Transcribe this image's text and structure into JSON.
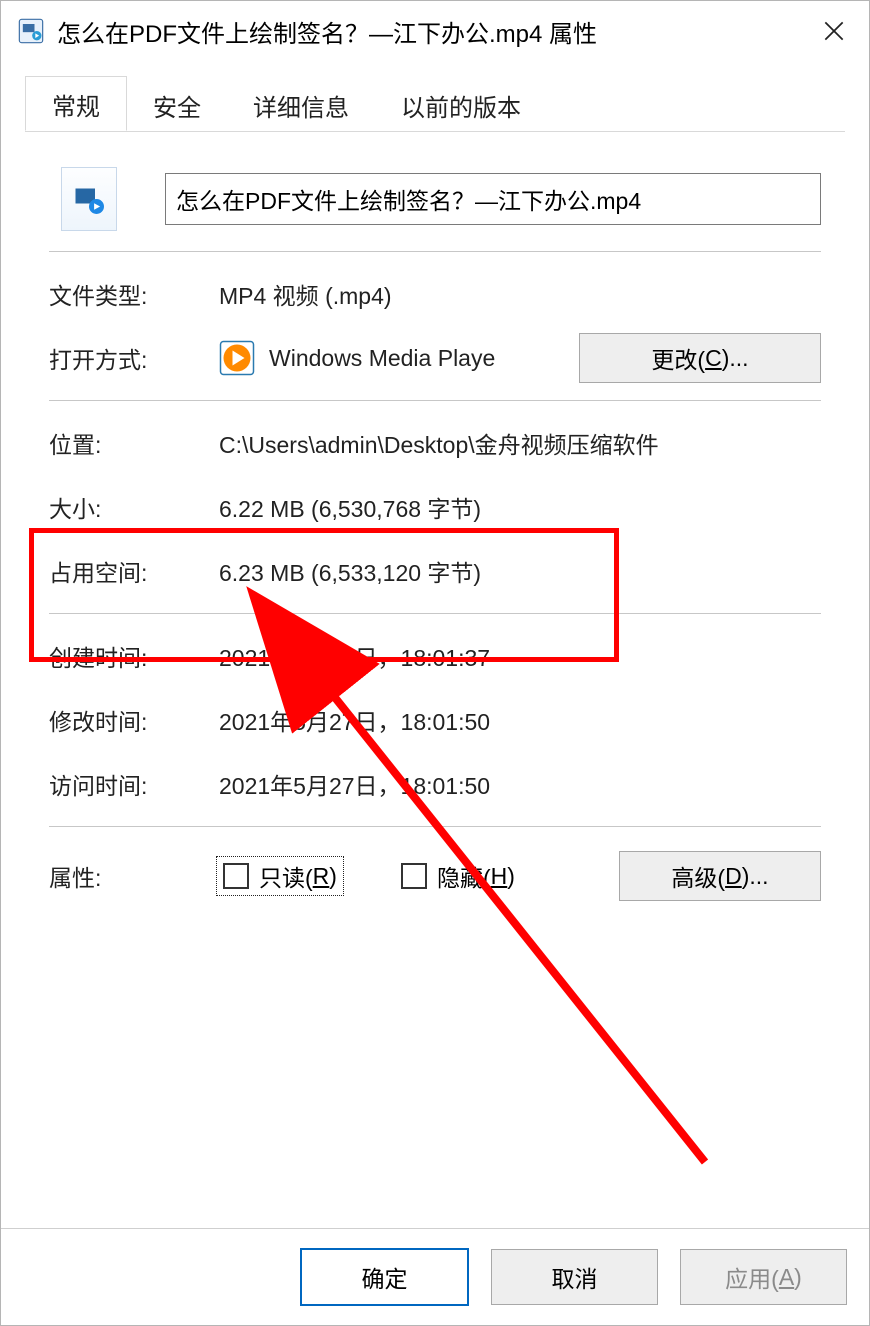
{
  "title": "怎么在PDF文件上绘制签名？—江下办公.mp4 属性",
  "tabs": [
    "常规",
    "安全",
    "详细信息",
    "以前的版本"
  ],
  "filename": "怎么在PDF文件上绘制签名？—江下办公.mp4",
  "labels": {
    "filetype": "文件类型:",
    "openwith": "打开方式:",
    "location": "位置:",
    "size": "大小:",
    "sizedisk": "占用空间:",
    "created": "创建时间:",
    "modified": "修改时间:",
    "accessed": "访问时间:",
    "attributes": "属性:",
    "readonly": "只读(",
    "readonly_key": "R",
    "readonly_close": ")",
    "hidden": "隐藏(",
    "hidden_key": "H",
    "hidden_close": ")",
    "change": "更改(",
    "change_key": "C",
    "change_close": ")...",
    "advanced": "高级(",
    "advanced_key": "D",
    "advanced_close": ")..."
  },
  "values": {
    "filetype": "MP4 视频 (.mp4)",
    "openwith": "Windows Media Playe",
    "location": "C:\\Users\\admin\\Desktop\\金舟视频压缩软件",
    "size": "6.22 MB (6,530,768 字节)",
    "sizedisk": "6.23 MB (6,533,120 字节)",
    "created": "2021年5月27日，18:01:37",
    "modified": "2021年5月27日，18:01:50",
    "accessed": "2021年5月27日，18:01:50"
  },
  "footer": {
    "ok": "确定",
    "cancel": "取消",
    "apply": "应用(",
    "apply_key": "A",
    "apply_close": ")"
  }
}
